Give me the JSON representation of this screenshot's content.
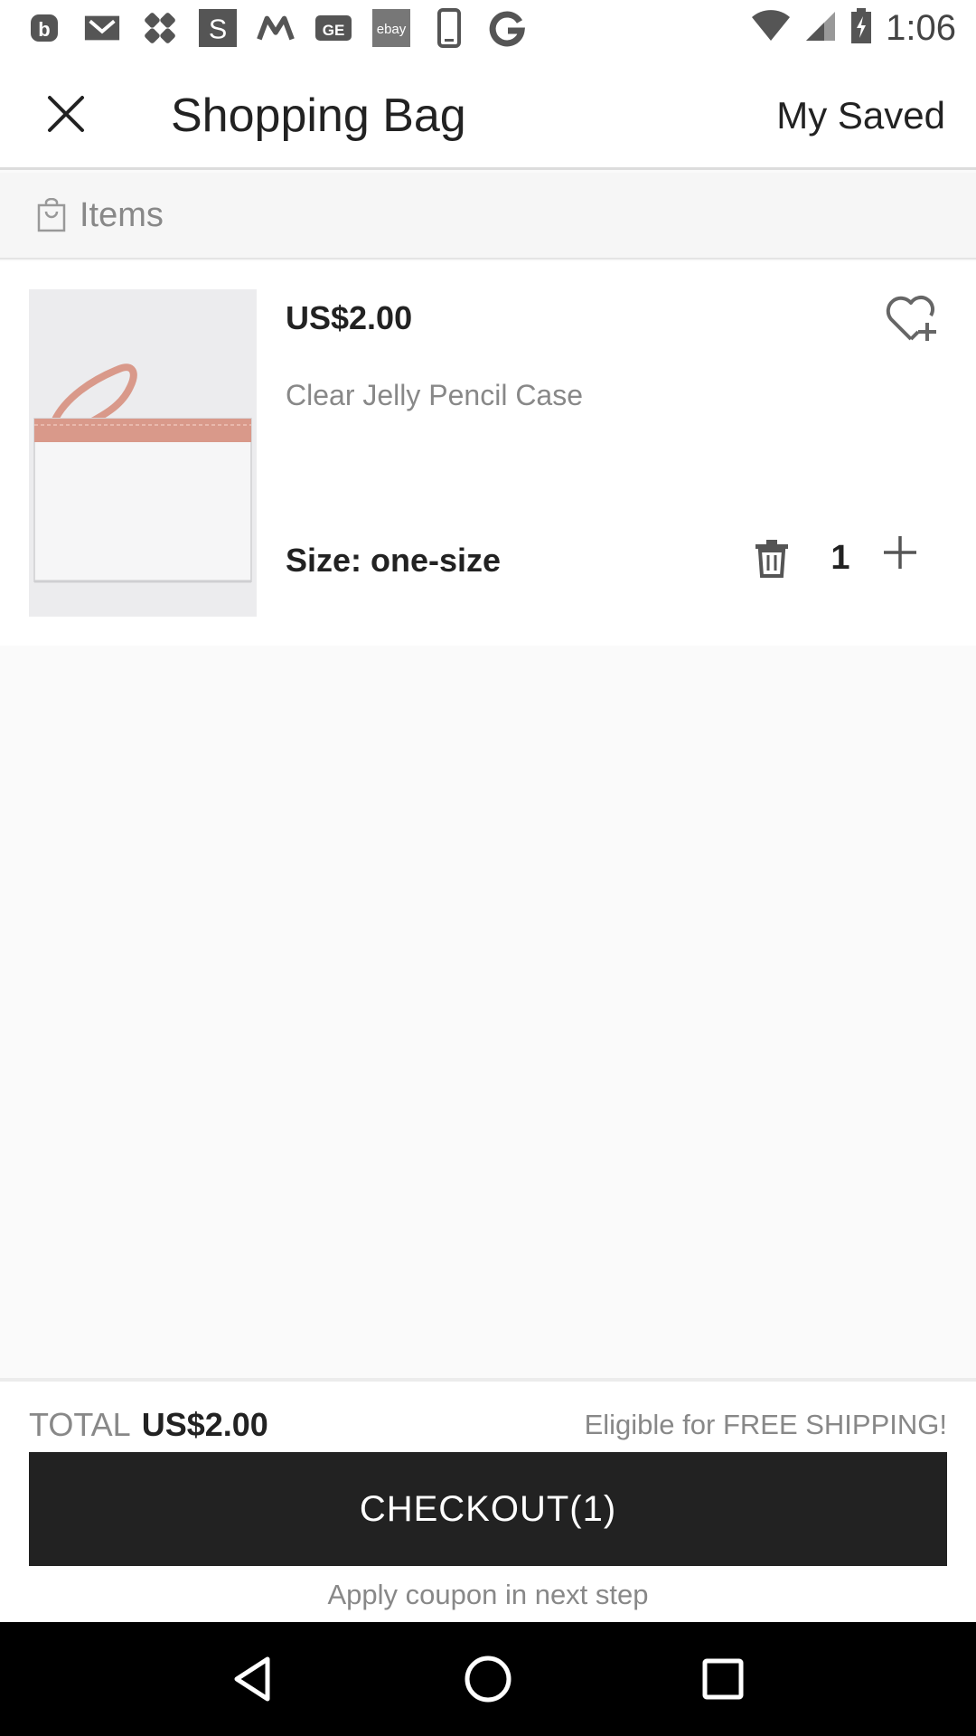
{
  "status_bar": {
    "time": "1:06",
    "notification_icons": [
      "b-icon",
      "gmail-icon",
      "app-diamond-icon",
      "s-icon",
      "m-icon",
      "ge-icon",
      "ebay-icon",
      "phone-icon",
      "g-icon"
    ]
  },
  "app_bar": {
    "title": "Shopping Bag",
    "my_saved_label": "My Saved"
  },
  "items_section": {
    "header_label": "Items"
  },
  "cart_item": {
    "price": "US$2.00",
    "name": "Clear Jelly Pencil Case",
    "size": "Size: one-size",
    "quantity": "1"
  },
  "footer": {
    "total_label": "TOTAL",
    "total_value": "US$2.00",
    "shipping_note": "Eligible for FREE SHIPPING!",
    "checkout_label": "CHECKOUT(1)",
    "coupon_note": "Apply coupon in next step"
  },
  "colors": {
    "checkout_bg": "#222222",
    "muted_text": "#888888",
    "product_strap": "#d9998a"
  }
}
